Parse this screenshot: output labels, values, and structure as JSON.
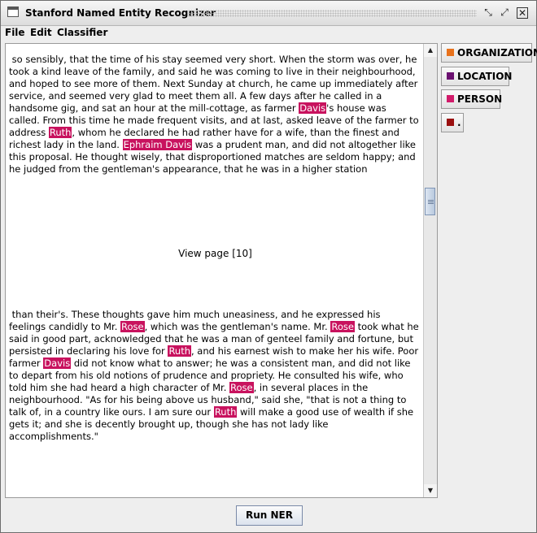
{
  "window": {
    "title": "Stanford Named Entity Recognizer"
  },
  "menu": {
    "items": [
      "File",
      "Edit",
      "Classifier"
    ]
  },
  "entities": [
    {
      "label": "ORGANIZATION",
      "color": "#e8721c"
    },
    {
      "label": "LOCATION",
      "color": "#6b1070"
    },
    {
      "label": "PERSON",
      "color": "#d11b6a"
    },
    {
      "label": ".",
      "color": "#9a0f0f"
    }
  ],
  "document": {
    "page_label": "View page [10]",
    "para1": [
      {
        "t": " so sensibly, that the time of his stay seemed very short. When the storm was over, he took a kind leave of the family, and said he was coming to live in their neighbourhood, and hoped to see more of them. Next Sunday at church, he came up immediately after service, and seemed very glad to meet them all. A few days after he called in a handsome gig, and sat an hour at the mill-cottage, as farmer ",
        "e": false
      },
      {
        "t": "Davis",
        "e": true
      },
      {
        "t": "'s house was called. From this time he made frequent visits, and at last, asked leave of the farmer to address ",
        "e": false
      },
      {
        "t": "Ruth",
        "e": true
      },
      {
        "t": ", whom he declared he had rather have for a wife, than the finest and richest lady in the land. ",
        "e": false
      },
      {
        "t": "Ephraim Davis",
        "e": true
      },
      {
        "t": " was a prudent man, and did not altogether like this proposal. He thought wisely, that disproportioned matches are seldom happy; and he judged from the gentleman's appearance, that he was in a higher station",
        "e": false
      }
    ],
    "para2": [
      {
        "t": " than their's. These thoughts gave him much uneasiness, and he expressed his feelings candidly to Mr. ",
        "e": false
      },
      {
        "t": "Rose",
        "e": true
      },
      {
        "t": ", which was the gentleman's name. Mr. ",
        "e": false
      },
      {
        "t": "Rose",
        "e": true
      },
      {
        "t": " took what he said in good part, acknowledged that he was a man of genteel family and fortune, but persisted in declaring his love for ",
        "e": false
      },
      {
        "t": "Ruth",
        "e": true
      },
      {
        "t": ", and his earnest wish to make her his wife. Poor farmer ",
        "e": false
      },
      {
        "t": "Davis",
        "e": true
      },
      {
        "t": " did not know what to answer; he was a consistent man, and did not like to depart from his old notions of prudence and propriety. He consulted his wife, who told him she had heard a high character of Mr. ",
        "e": false
      },
      {
        "t": "Rose",
        "e": true
      },
      {
        "t": ", in several places in the neighbourhood. \"As for his being above us husband,\" said she, \"that is not a thing to talk of, in a country like ours. I am sure our ",
        "e": false
      },
      {
        "t": "Ruth",
        "e": true
      },
      {
        "t": " will make a good use of wealth if she gets it; and she is decently brought up, though she has not lady like accomplishments.\"",
        "e": false
      }
    ]
  },
  "run_button": {
    "label": "Run NER"
  }
}
